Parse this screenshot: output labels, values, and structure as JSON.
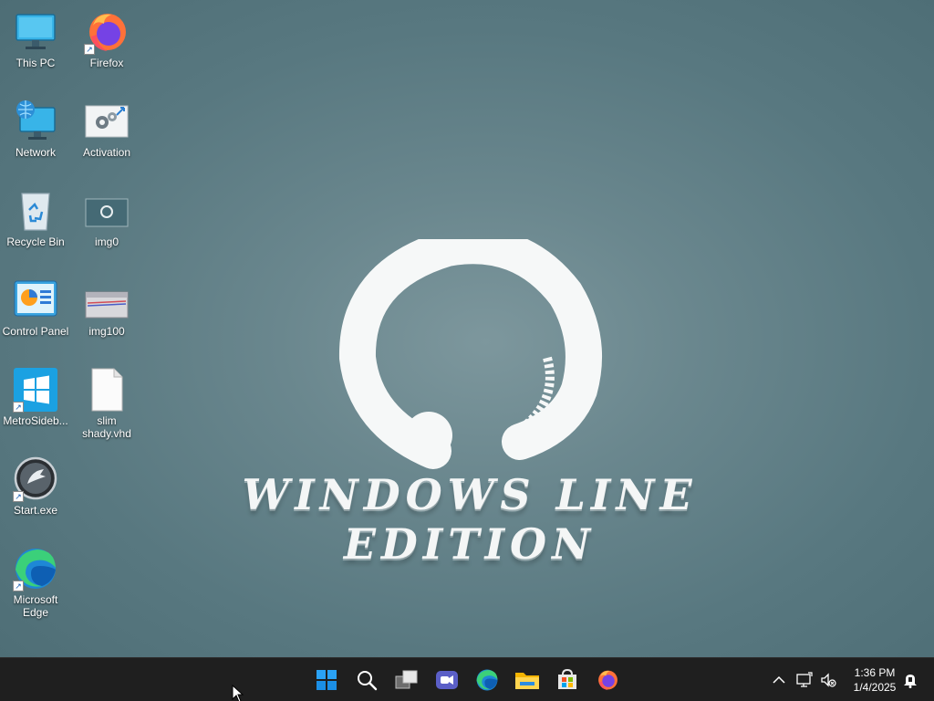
{
  "desktop_icons": [
    {
      "label": "This PC",
      "icon": "this-pc-icon"
    },
    {
      "label": "Firefox",
      "icon": "firefox-icon"
    },
    {
      "label": "Network",
      "icon": "network-icon"
    },
    {
      "label": "Activation",
      "icon": "activation-icon"
    },
    {
      "label": "Recycle Bin",
      "icon": "recycle-bin-icon"
    },
    {
      "label": "img0",
      "icon": "image-file-icon"
    },
    {
      "label": "Control Panel",
      "icon": "control-panel-icon"
    },
    {
      "label": "img100",
      "icon": "image-file-icon"
    },
    {
      "label": "MetroSideb...",
      "icon": "windows-tiles-icon"
    },
    {
      "label": "slim shady.vhd",
      "icon": "document-file-icon"
    },
    {
      "label": "Start.exe",
      "icon": "start-orb-icon"
    },
    {
      "label": "Microsoft Edge",
      "icon": "edge-icon"
    }
  ],
  "wallpaper": {
    "caption": "WINDOWS LINE EDITION"
  },
  "taskbar": {
    "buttons": [
      "start-icon",
      "search-icon",
      "task-view-icon",
      "chat-icon",
      "edge-icon",
      "file-explorer-icon",
      "store-icon",
      "firefox-icon"
    ],
    "tray": [
      "chevron-up-icon",
      "network-icon",
      "volume-muted-icon",
      "notification-icon"
    ],
    "time": "1:36 PM",
    "date": "1/4/2025"
  },
  "colors": {
    "taskbar_bg": "#1f1f1f",
    "desktop_bg": "#5f7f88",
    "accent_blue": "#0078d4"
  }
}
